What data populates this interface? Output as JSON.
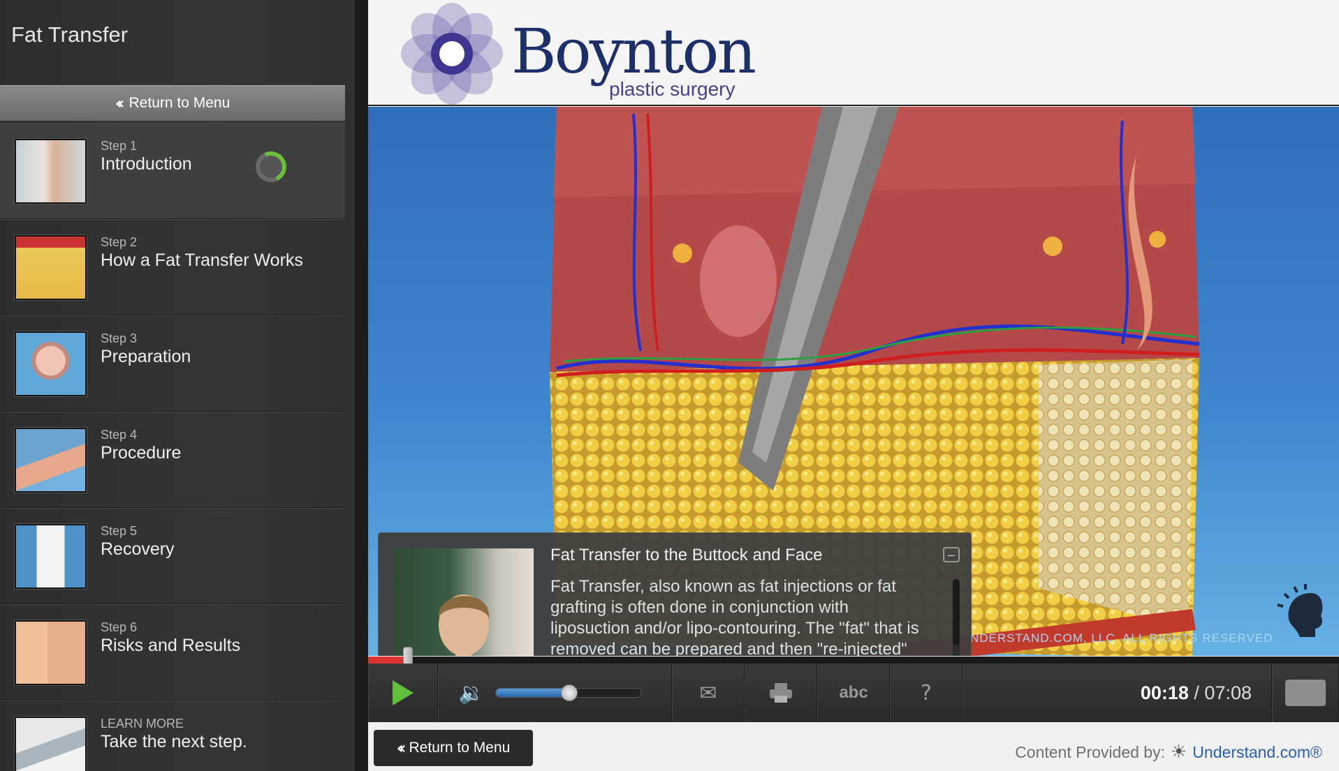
{
  "sidebar": {
    "title": "Fat Transfer",
    "return_label": "Return to Menu",
    "steps": [
      {
        "num": "Step 1",
        "name": "Introduction",
        "thumb": "woman-standing-thumb"
      },
      {
        "num": "Step 2",
        "name": "How a Fat Transfer Works",
        "thumb": "fat-layer-thumb"
      },
      {
        "num": "Step 3",
        "name": "Preparation",
        "thumb": "marked-buttock-thumb"
      },
      {
        "num": "Step 4",
        "name": "Procedure",
        "thumb": "cannula-procedure-thumb"
      },
      {
        "num": "Step 5",
        "name": "Recovery",
        "thumb": "compression-garment-thumb"
      },
      {
        "num": "Step 6",
        "name": "Risks and Results",
        "thumb": "buttocks-results-thumb"
      },
      {
        "num": "LEARN MORE",
        "name": "Take the next step.",
        "thumb": "woman-phone-thumb"
      }
    ]
  },
  "header": {
    "brand": "Boynton",
    "brand_sub": "plastic surgery",
    "logo_color": "#5d54a3"
  },
  "video": {
    "watermark": "NDERSTAND.COM, LLC. ALL RIGHTS RESERVED"
  },
  "info_panel": {
    "title": "Fat Transfer to the Buttock and Face",
    "body": "Fat Transfer, also known as fat injections or fat grafting is often done in conjunction with liposuction and/or lipo-contouring. The \"fat\" that is removed can be prepared and then \"re-injected\" into other areas of the body that are deficient in \"volume\" such at the buttock. Fat in also injected into the face using micro fat or",
    "minimize_symbol": "–"
  },
  "player": {
    "progress_fraction": 0.042,
    "volume_fraction": 0.5,
    "current_time": "00:18",
    "separator": " / ",
    "total_time": "07:08",
    "abc_label": "abc",
    "help_label": "?",
    "icons": [
      "play-icon",
      "speaker-icon",
      "email-icon",
      "print-icon",
      "captions-icon",
      "help-icon",
      "fullscreen-icon"
    ],
    "accent_play": "#61c13a",
    "accent_progress": "#dd3333"
  },
  "footer": {
    "return_label": "Return to Menu",
    "credit_prefix": "Content Provided by:",
    "credit_brand": "Understand.com®"
  }
}
